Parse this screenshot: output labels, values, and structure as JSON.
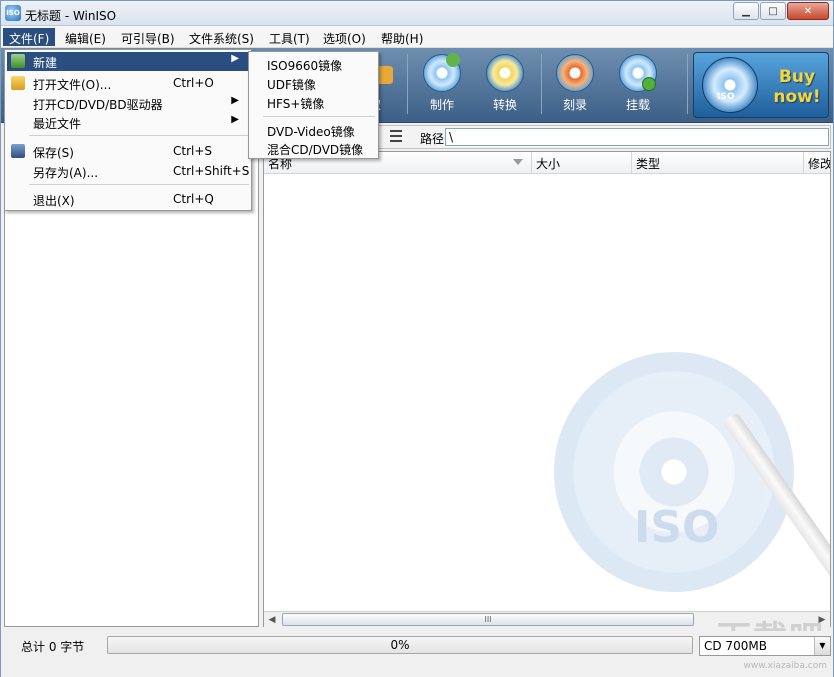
{
  "window": {
    "title": "无标题 - WinISO",
    "app_icon_text": "ISO"
  },
  "menubar": [
    {
      "label": "文件(F)"
    },
    {
      "label": "编辑(E)"
    },
    {
      "label": "可引导(B)"
    },
    {
      "label": "文件系统(S)"
    },
    {
      "label": "工具(T)"
    },
    {
      "label": "选项(O)"
    },
    {
      "label": "帮助(H)"
    }
  ],
  "toolbar": {
    "partial_label": "取",
    "make": "制作",
    "convert": "转换",
    "burn": "刻录",
    "mount": "挂载",
    "buy": "Buy now!",
    "buy_disc": "ISO"
  },
  "file_menu": {
    "new": "新建",
    "open": "打开文件(O)...",
    "open_sc": "Ctrl+O",
    "open_drive": "打开CD/DVD/BD驱动器",
    "recent": "最近文件",
    "save": "保存(S)",
    "save_sc": "Ctrl+S",
    "saveas": "另存为(A)...",
    "saveas_sc": "Ctrl+Shift+S",
    "exit": "退出(X)",
    "exit_sc": "Ctrl+Q"
  },
  "new_submenu": [
    "ISO9660镜像",
    "UDF镜像",
    "HFS+镜像",
    "DVD-Video镜像",
    "混合CD/DVD镜像"
  ],
  "pathbar": {
    "label": "路径",
    "value": "\\"
  },
  "columns": [
    "名称",
    "大小",
    "类型",
    "修改"
  ],
  "watermark": {
    "text": "ISO",
    "brand": "下载吧",
    "site": "www.xiazaiba.com"
  },
  "status": {
    "total": "总计 0 字节",
    "progress_text": "0%",
    "progress": 0,
    "media": "CD 700MB"
  }
}
